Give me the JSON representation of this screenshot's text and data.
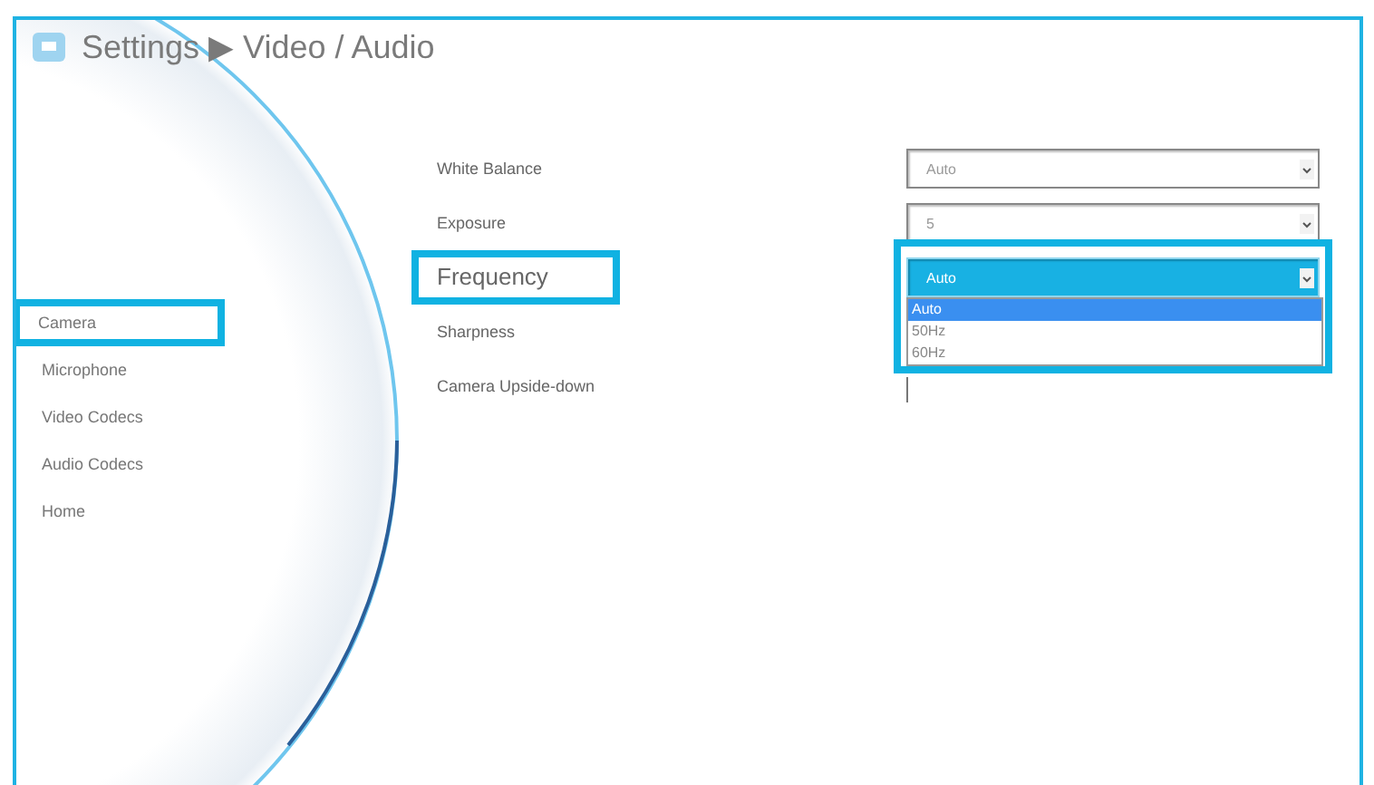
{
  "header": {
    "title": "Settings ▶ Video / Audio"
  },
  "nav": [
    {
      "label": "Camera",
      "highlighted": true
    },
    {
      "label": "Microphone",
      "highlighted": false
    },
    {
      "label": "Video Codecs",
      "highlighted": false
    },
    {
      "label": "Audio Codecs",
      "highlighted": false
    },
    {
      "label": "Home",
      "highlighted": false
    }
  ],
  "settings": [
    {
      "label": "White Balance",
      "kind": "select",
      "value": "Auto",
      "open": false,
      "highlighted": false
    },
    {
      "label": "Exposure",
      "kind": "select",
      "value": "5",
      "open": false,
      "highlighted": false
    },
    {
      "label": "Frequency",
      "kind": "select",
      "value": "Auto",
      "open": true,
      "highlighted": true,
      "options": [
        {
          "label": "Auto",
          "selected": true
        },
        {
          "label": "50Hz",
          "selected": false
        },
        {
          "label": "60Hz",
          "selected": false
        }
      ]
    },
    {
      "label": "Sharpness",
      "kind": "none",
      "highlighted": false
    },
    {
      "label": "Camera Upside-down",
      "kind": "partial",
      "highlighted": false
    }
  ]
}
